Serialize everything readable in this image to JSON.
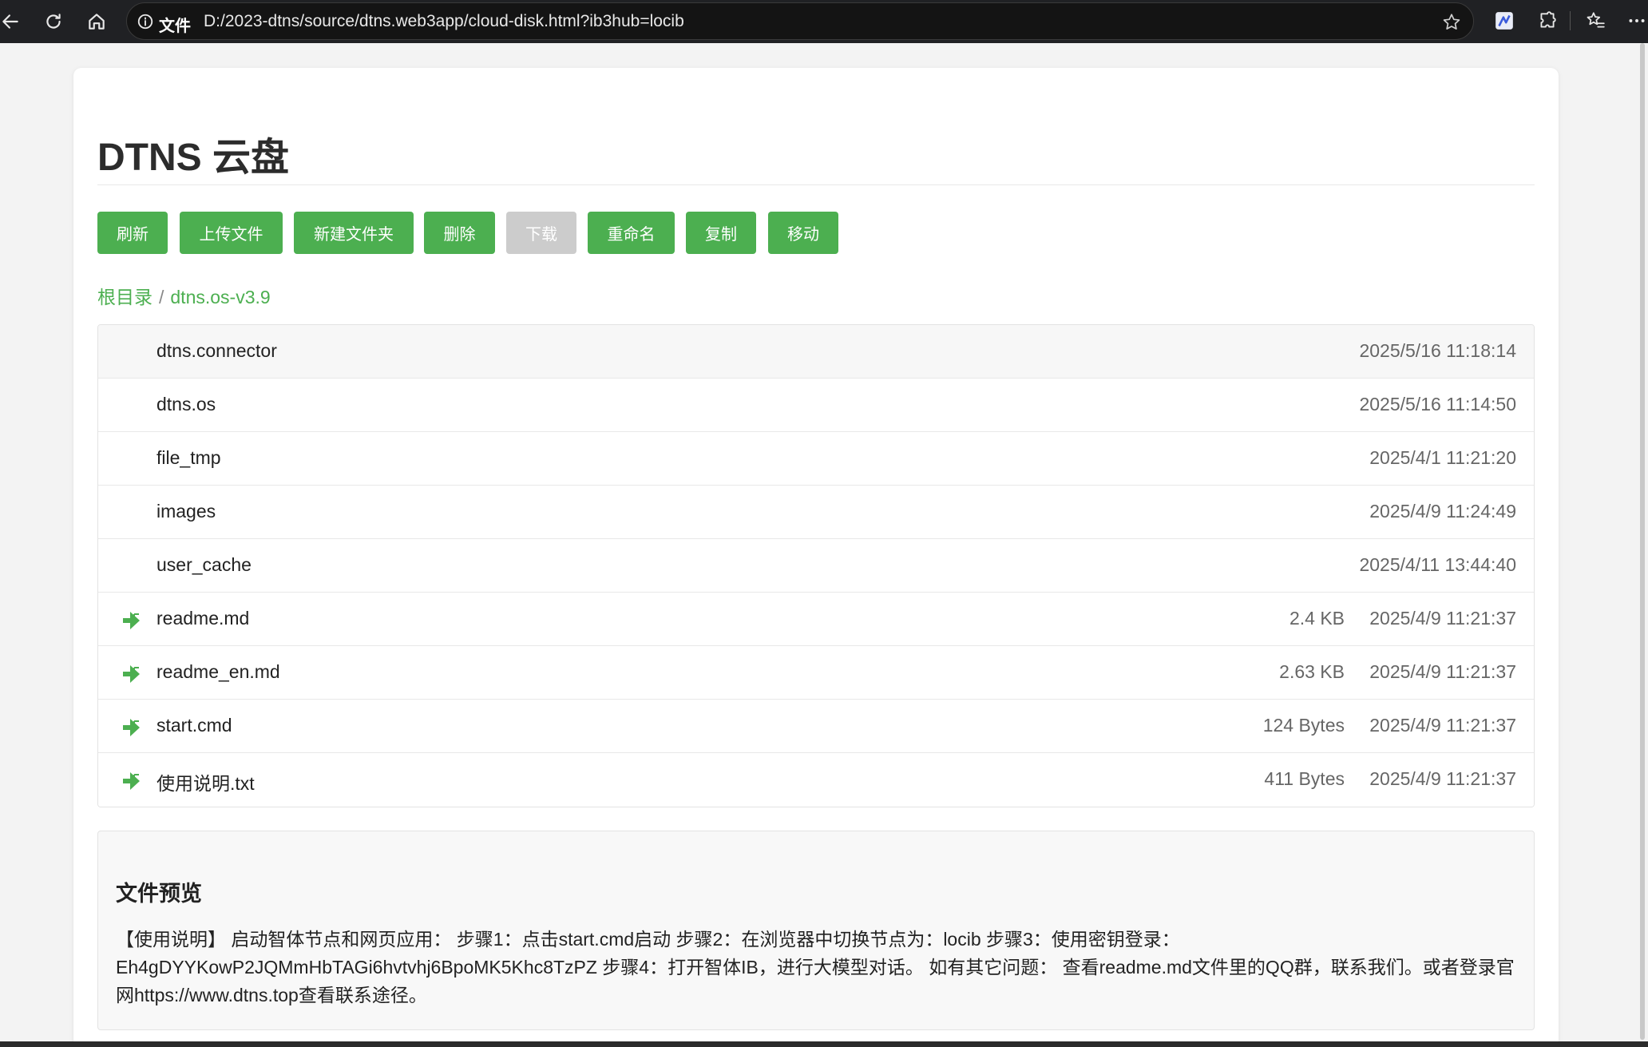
{
  "browser": {
    "protocol_label": "文件",
    "url": "D:/2023-dtns/source/dtns.web3app/cloud-disk.html?ib3hub=locib",
    "icons": [
      "back-icon",
      "reload-icon",
      "home-icon",
      "info-icon",
      "star-icon",
      "extension-logo-icon",
      "puzzle-icon",
      "favorites-icon",
      "more-icon"
    ]
  },
  "page": {
    "title": "DTNS 云盘"
  },
  "toolbar": {
    "refresh": "刷新",
    "upload": "上传文件",
    "new_folder": "新建文件夹",
    "delete": "删除",
    "download": "下载",
    "rename": "重命名",
    "copy": "复制",
    "move": "移动"
  },
  "breadcrumb": {
    "root": "根目录",
    "separator": "/",
    "current": "dtns.os-v3.9"
  },
  "files": [
    {
      "name": "dtns.connector",
      "size": "",
      "date": "2025/5/16 11:18:14",
      "type": "folder"
    },
    {
      "name": "dtns.os",
      "size": "",
      "date": "2025/5/16 11:14:50",
      "type": "folder"
    },
    {
      "name": "file_tmp",
      "size": "",
      "date": "2025/4/1 11:21:20",
      "type": "folder"
    },
    {
      "name": "images",
      "size": "",
      "date": "2025/4/9 11:24:49",
      "type": "folder"
    },
    {
      "name": "user_cache",
      "size": "",
      "date": "2025/4/11 13:44:40",
      "type": "folder"
    },
    {
      "name": "readme.md",
      "size": "2.4 KB",
      "date": "2025/4/9 11:21:37",
      "type": "file"
    },
    {
      "name": "readme_en.md",
      "size": "2.63 KB",
      "date": "2025/4/9 11:21:37",
      "type": "file"
    },
    {
      "name": "start.cmd",
      "size": "124 Bytes",
      "date": "2025/4/9 11:21:37",
      "type": "file"
    },
    {
      "name": "使用说明.txt",
      "size": "411 Bytes",
      "date": "2025/4/9 11:21:37",
      "type": "file"
    }
  ],
  "preview": {
    "title": "文件预览",
    "content": "【使用说明】 启动智体节点和网页应用： 步骤1：点击start.cmd启动 步骤2：在浏览器中切换节点为：locib 步骤3：使用密钥登录：Eh4gDYYKowP2JQMmHbTAGi6hvtvhj6BpoMK5Khc8TzPZ 步骤4：打开智体IB，进行大模型对话。 如有其它问题： 查看readme.md文件里的QQ群，联系我们。或者登录官网https://www.dtns.top查看联系途径。"
  },
  "colors": {
    "accent": "#4caf50",
    "disabled": "#cccccc",
    "chrome_bg": "#202124"
  }
}
